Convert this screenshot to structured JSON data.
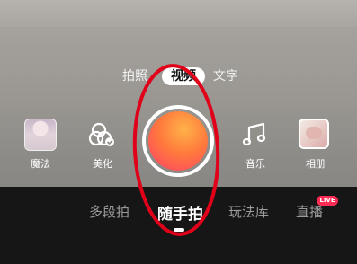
{
  "modes": {
    "photo": "拍照",
    "video": "视频",
    "text": "文字"
  },
  "tools": {
    "magic": "魔法",
    "beauty": "美化",
    "music": "音乐",
    "album": "相册"
  },
  "bottom_tabs": {
    "multi_segment": "多段拍",
    "casual": "随手拍",
    "gameplay": "玩法库",
    "live": "直播",
    "live_badge": "LIVE"
  },
  "colors": {
    "accent": "#fe2c55",
    "annotation": "#e0001a"
  }
}
